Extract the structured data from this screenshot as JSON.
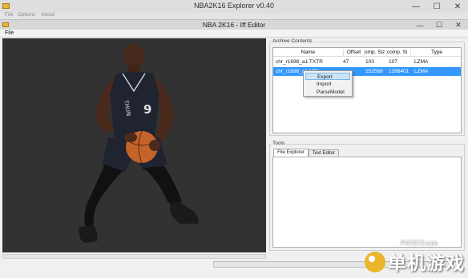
{
  "outer_window": {
    "title": "NBA2K16 Explorer v0.40",
    "menu": [
      "File",
      "Options",
      "About"
    ],
    "controls": {
      "minimize": "—",
      "maximize": "☐",
      "close": "✕"
    }
  },
  "inner_window": {
    "title": "NBA 2K16 - Iff Editor",
    "menu": [
      "File"
    ],
    "controls": {
      "minimize": "—",
      "maximize": "☐",
      "close": "✕"
    }
  },
  "archive": {
    "label": "Archive Contents",
    "columns": [
      "Name",
      "Offset",
      "omp. Siz",
      "comp. Si",
      "Type"
    ],
    "rows": [
      {
        "name": "chr_r1698_a1.TXTR",
        "offset": "47",
        "comp_size": "103",
        "decomp_size": "107",
        "type": "LZMA",
        "selected": false
      },
      {
        "name": "chr_r1698_a1.MDL",
        "offset": "",
        "comp_size": "152568",
        "decomp_size": "1398401",
        "type": "LZMA",
        "selected": true
      }
    ]
  },
  "context_menu": {
    "items": [
      {
        "label": "Export",
        "highlighted": true
      },
      {
        "label": "Import",
        "highlighted": false
      },
      {
        "label": "ParseModel",
        "highlighted": false
      }
    ]
  },
  "tools": {
    "label": "Tools",
    "tabs": [
      {
        "label": "File Explorer",
        "active": true
      },
      {
        "label": "Text Editor",
        "active": false
      }
    ]
  },
  "watermark": {
    "url": "P.07073.com",
    "text": "单机游戏"
  },
  "colors": {
    "selection": "#3399ff",
    "preview_background": "#323232",
    "jersey": "#1f2430"
  }
}
